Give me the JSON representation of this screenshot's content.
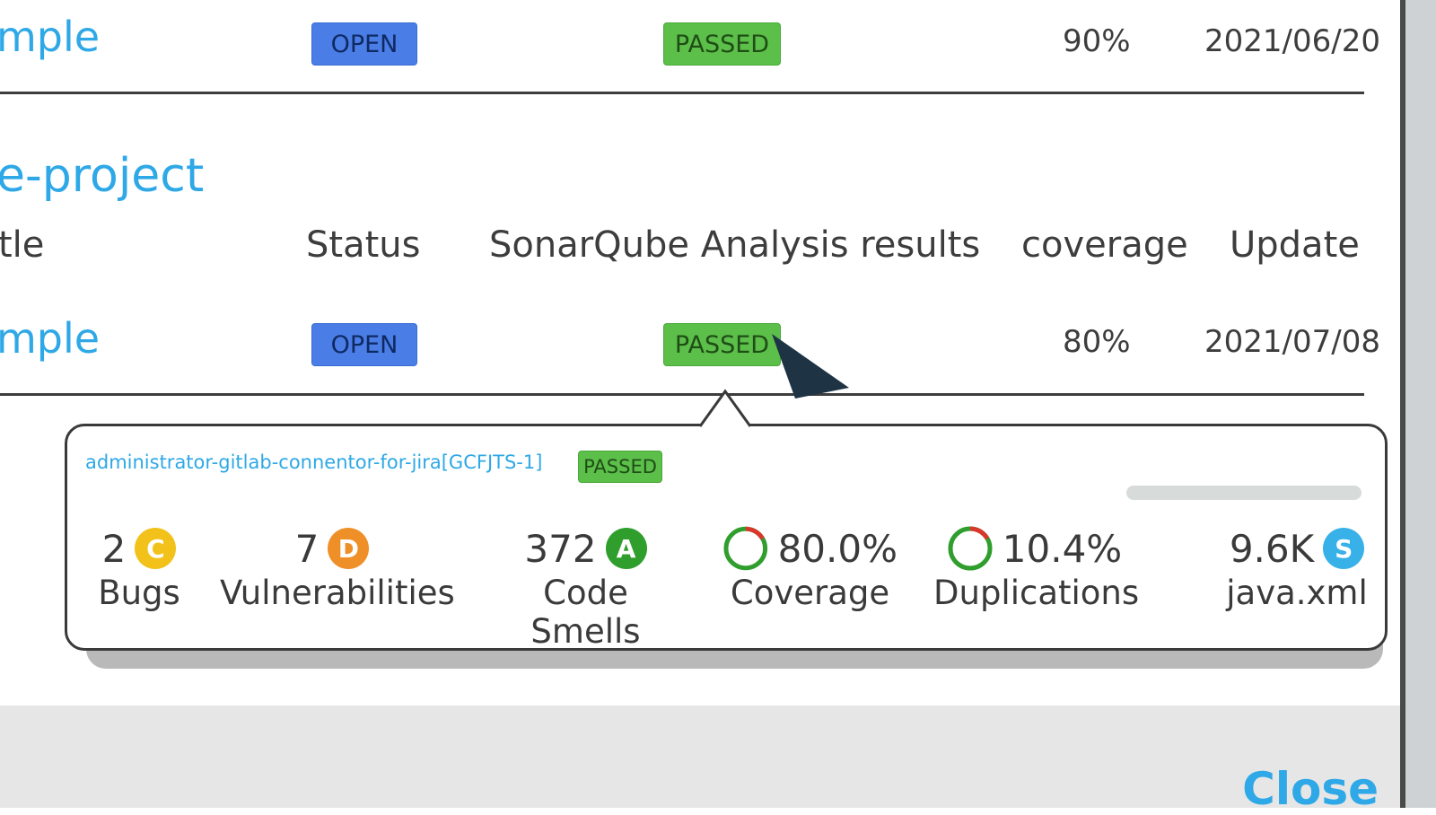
{
  "row1": {
    "title": "mple",
    "status": "OPEN",
    "analysis": "PASSED",
    "coverage": "90%",
    "updated": "2021/06/20"
  },
  "project2": {
    "name": "e-project",
    "columns": {
      "title": "tle",
      "status": "Status",
      "analysis": "SonarQube Analysis results",
      "coverage": "coverage",
      "updated": "Update"
    },
    "row": {
      "title": "mple",
      "status": "OPEN",
      "analysis": "PASSED",
      "coverage": "80%",
      "updated": "2021/07/08"
    }
  },
  "popover": {
    "project": "administrator-gitlab-connentor-for-jira[GCFJTS-1]",
    "gate": "PASSED",
    "metrics": {
      "bugs": {
        "value": "2",
        "grade": "C",
        "label": "Bugs"
      },
      "vulnerabilities": {
        "value": "7",
        "grade": "D",
        "label": "Vulnerabilities"
      },
      "code_smells": {
        "value": "372",
        "grade": "A",
        "label": "Code Smells"
      },
      "coverage": {
        "value": "80.0%",
        "label": "Coverage"
      },
      "duplications": {
        "value": "10.4%",
        "label": "Duplications"
      },
      "size": {
        "value": "9.6K",
        "grade": "S",
        "label": "java.xml"
      }
    },
    "colors": {
      "grade_c": "#f2c21b",
      "grade_d": "#ef8f27",
      "grade_a": "#2f9e2d",
      "grade_s": "#38b0e8"
    }
  },
  "footer": {
    "close_label": "Close"
  }
}
